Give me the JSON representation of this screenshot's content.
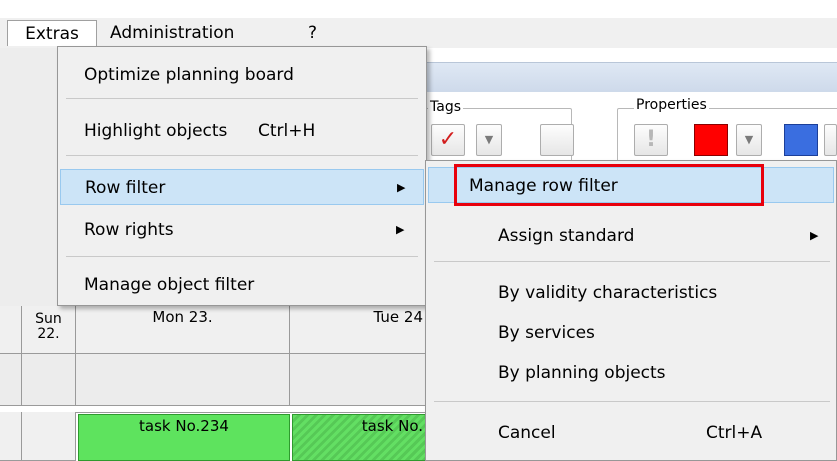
{
  "menubar": {
    "items": [
      "Extras",
      "Administration",
      "?"
    ]
  },
  "ribbon": {
    "tags_label": "Tags",
    "properties_label": "Properties",
    "check_glyph": "✓",
    "exclaim_glyph": "!"
  },
  "extras_menu": {
    "items": [
      {
        "label": "Optimize planning board",
        "shortcut": ""
      },
      {
        "label": "Highlight objects",
        "shortcut": "Ctrl+H"
      },
      {
        "label": "Row filter",
        "shortcut": "",
        "submenu": true,
        "highlighted": true
      },
      {
        "label": "Row rights",
        "shortcut": "",
        "submenu": true
      },
      {
        "label": "Manage object filter",
        "shortcut": ""
      }
    ]
  },
  "row_filter_submenu": {
    "items": [
      {
        "label": "Manage row filter",
        "highlighted": true,
        "outlined": true
      },
      {
        "label": "Assign standard",
        "submenu": true
      },
      {
        "label": "By validity characteristics"
      },
      {
        "label": "By services"
      },
      {
        "label": "By planning objects"
      },
      {
        "label": "Cancel",
        "shortcut": "Ctrl+A"
      }
    ]
  },
  "board": {
    "day_headers": [
      "Sun 22.",
      "Mon 23.",
      "Tue 24"
    ],
    "tasks": [
      "task No.234",
      "task No."
    ]
  },
  "colors": {
    "highlight": "#cce4f7",
    "task_green": "#5ee35e",
    "outline_red": "#e8000c",
    "swatch_red": "#ff0000",
    "swatch_blue": "#3a6ee0"
  }
}
